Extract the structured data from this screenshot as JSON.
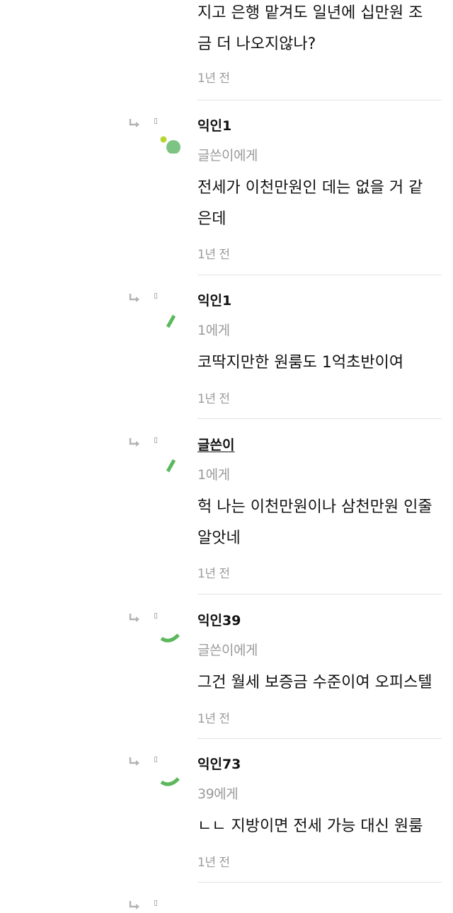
{
  "top_comment": {
    "body_lines": [
      "지고 은행 맡겨도 일년에 십만원 조",
      "금 더 나오지않나?"
    ],
    "time": "1년 전"
  },
  "replies": [
    {
      "author": "익인1",
      "is_post_author": false,
      "target": "글쓴이에게",
      "body_lines": [
        "전세가 이천만원인 데는 없을 거 같",
        "은데"
      ],
      "time": "1년 전",
      "avatar_icon": "green-dots-avatar-icon"
    },
    {
      "author": "익인1",
      "is_post_author": false,
      "target": "1에게",
      "body_lines": [
        "코딱지만한 원룸도 1억초반이여"
      ],
      "time": "1년 전",
      "avatar_icon": "green-slash-avatar-icon"
    },
    {
      "author": "글쓴이",
      "is_post_author": true,
      "target": "1에게",
      "body_lines": [
        "헉 나는 이천만원이나 삼천만원 인줄",
        "알앗네"
      ],
      "time": "1년 전",
      "avatar_icon": "green-slash-avatar-icon"
    },
    {
      "author": "익인39",
      "is_post_author": false,
      "target": "글쓴이에게",
      "body_lines": [
        "그건 월세 보증금 수준이여 오피스텔"
      ],
      "time": "1년 전",
      "avatar_icon": "green-arc-avatar-icon"
    },
    {
      "author": "익인73",
      "is_post_author": false,
      "target": "39에게",
      "body_lines": [
        "ㄴㄴ 지방이면 전세 가능 대신 원룸"
      ],
      "time": "1년 전",
      "avatar_icon": "green-arc-avatar-icon"
    }
  ],
  "colors": {
    "accent_green": "#5cb85c",
    "avatar_green": "#7dc383",
    "lime": "#b5d634",
    "muted": "#9a9a9a"
  }
}
